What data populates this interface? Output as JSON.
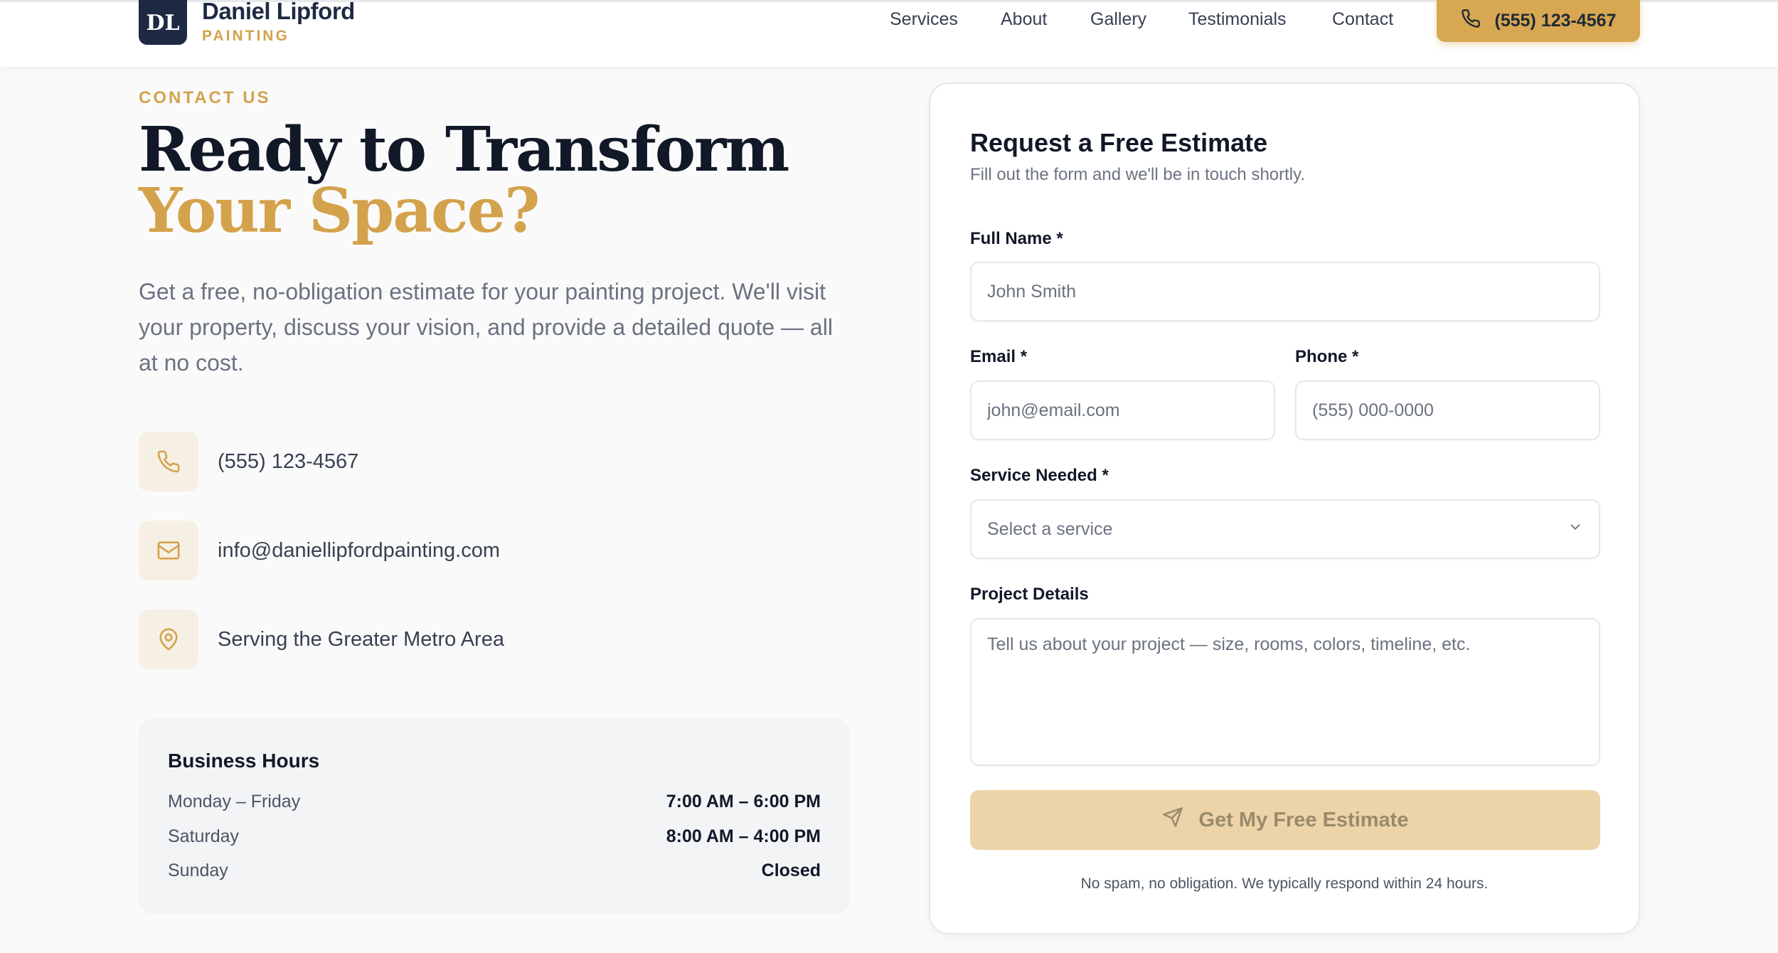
{
  "brand": {
    "initials": "DL",
    "name": "Daniel Lipford",
    "tagline": "PAINTING"
  },
  "nav": {
    "items": [
      "Services",
      "About",
      "Gallery",
      "Testimonials",
      "Contact"
    ],
    "cta_phone": "(555) 123-4567"
  },
  "hero": {
    "eyebrow": "CONTACT US",
    "title_part1": "Ready to Transform ",
    "title_accent": "Your Space?",
    "subtitle": "Get a free, no-obligation estimate for your painting project. We'll visit your property, discuss your vision, and provide a detailed quote — all at no cost."
  },
  "contact": {
    "phone": "(555) 123-4567",
    "email": "info@daniellipfordpainting.com",
    "location": "Serving the Greater Metro Area"
  },
  "hours": {
    "title": "Business Hours",
    "rows": [
      {
        "day": "Monday – Friday",
        "time": "7:00 AM – 6:00 PM"
      },
      {
        "day": "Saturday",
        "time": "8:00 AM – 4:00 PM"
      },
      {
        "day": "Sunday",
        "time": "Closed"
      }
    ]
  },
  "form": {
    "title": "Request a Free Estimate",
    "subtitle": "Fill out the form and we'll be in touch shortly.",
    "name_label": "Full Name *",
    "name_placeholder": "John Smith",
    "email_label": "Email *",
    "email_placeholder": "john@email.com",
    "phone_label": "Phone *",
    "phone_placeholder": "(555) 000-0000",
    "service_label": "Service Needed *",
    "service_selected": "Select a service",
    "details_label": "Project Details",
    "details_placeholder": "Tell us about your project — size, rooms, colors, timeline, etc.",
    "submit_label": "Get My Free Estimate",
    "note": "No spam, no obligation. We typically respond within 24 hours."
  },
  "colors": {
    "accent": "#d4a24c",
    "navy": "#1e2a44",
    "submit_disabled": "#ecd4a8"
  }
}
